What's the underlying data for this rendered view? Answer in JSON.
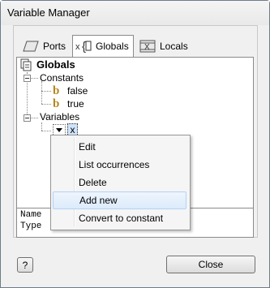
{
  "window": {
    "title": "Variable Manager"
  },
  "tabs": [
    {
      "label": "Ports",
      "icon": "ports-icon"
    },
    {
      "label": "Globals",
      "icon": "globals-icon"
    },
    {
      "label": "Locals",
      "icon": "locals-icon"
    }
  ],
  "tree": {
    "root": "Globals",
    "constants_label": "Constants",
    "constants": [
      "false",
      "true"
    ],
    "variables_label": "Variables",
    "selected_variable": "x"
  },
  "info": {
    "name_label": "Name",
    "type_label": "Type  I"
  },
  "context_menu": {
    "items": [
      "Edit",
      "List occurrences",
      "Delete",
      "Add new",
      "Convert to constant"
    ],
    "hovered": "Add new"
  },
  "buttons": {
    "help": "?",
    "close": "Close"
  }
}
